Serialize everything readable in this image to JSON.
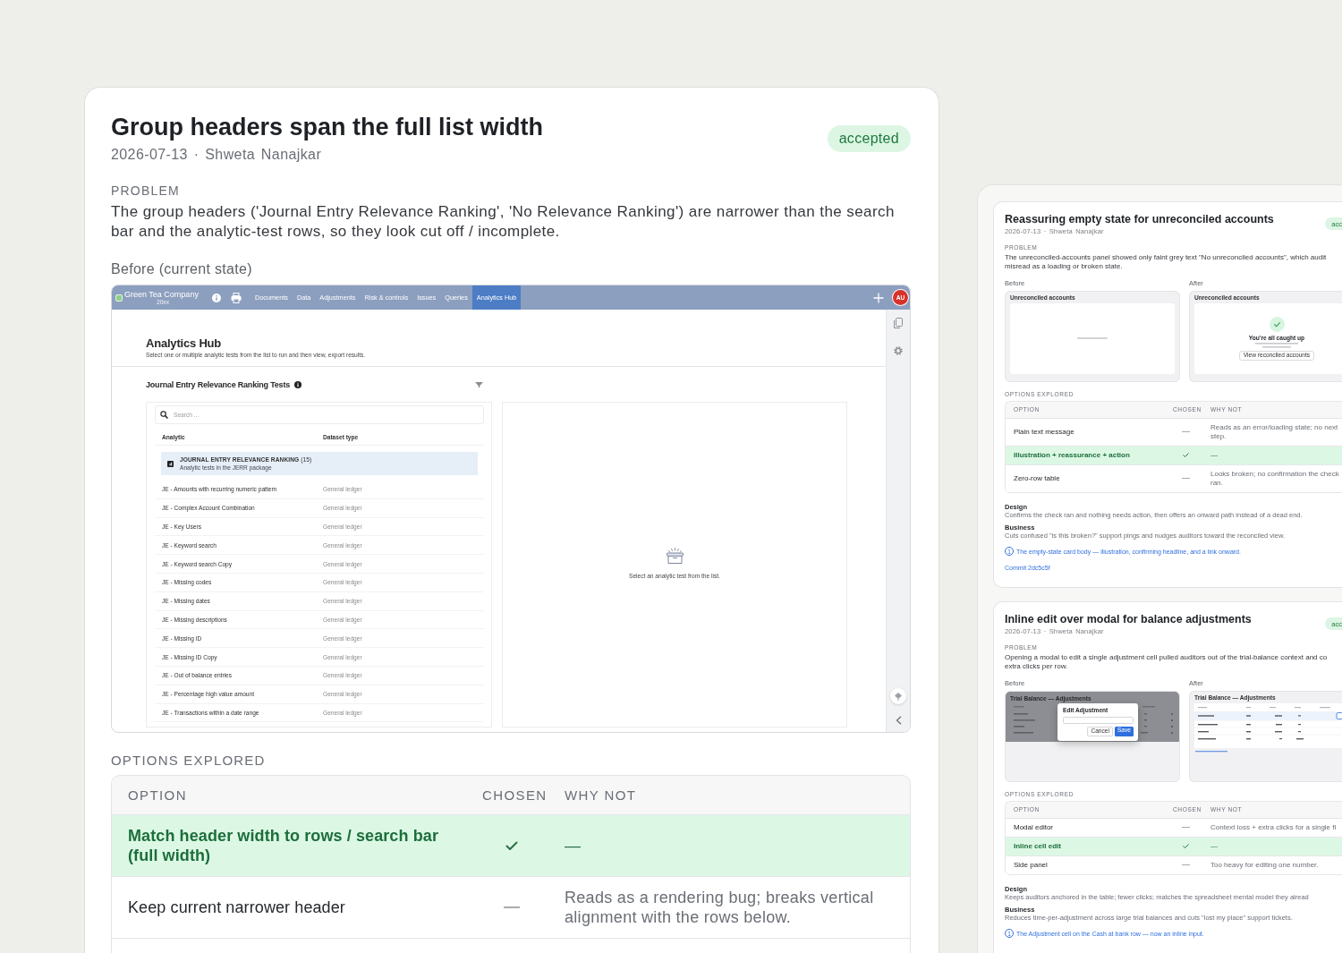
{
  "main_decision": {
    "title": "Group headers span the full list width",
    "byline": "2026-07-13 · Shweta Nanajkar",
    "status": "accepted",
    "problem_label": "PROBLEM",
    "problem": "The group headers ('Journal Entry Relevance Ranking', 'No Relevance Ranking') are narrower than the search bar and the analytic-test rows, so they look cut off / incomplete.",
    "before_label": "Before (current state)",
    "before_screenshot": {
      "company": "Green Tea Company",
      "company_year": "20xx",
      "nav": [
        {
          "label": "Documents",
          "selected": false
        },
        {
          "label": "Data",
          "selected": false
        },
        {
          "label": "Adjustments",
          "selected": false
        },
        {
          "label": "Risk & controls",
          "selected": false
        },
        {
          "label": "Issues",
          "selected": false
        },
        {
          "label": "Queries",
          "selected": false
        },
        {
          "label": "Analytics Hub",
          "selected": true
        }
      ],
      "avatar": "AU",
      "page_title": "Analytics Hub",
      "page_subtitle": "Select one or multiple analytic tests from the list to run and then view, export results.",
      "section_title": "Journal Entry Relevance Ranking Tests",
      "search_placeholder": "Search ...",
      "columns": [
        "Analytic",
        "Dataset type"
      ],
      "group": {
        "title": "**JOURNAL ENTRY RELEVANCE RANKING** (15)",
        "subtitle": "Analytic tests in the JERR package"
      },
      "rows": [
        {
          "analytic": "JE - Amounts with recurring numeric pattern",
          "dataset_type": "General ledger"
        },
        {
          "analytic": "JE - Complex Account Combination",
          "dataset_type": "General ledger"
        },
        {
          "analytic": "JE - Key Users",
          "dataset_type": "General ledger"
        },
        {
          "analytic": "JE - Keyword search",
          "dataset_type": "General ledger"
        },
        {
          "analytic": "JE - Keyword search Copy",
          "dataset_type": "General ledger"
        },
        {
          "analytic": "JE - Missing codes",
          "dataset_type": "General ledger"
        },
        {
          "analytic": "JE - Missing dates",
          "dataset_type": "General ledger"
        },
        {
          "analytic": "JE - Missing descriptions",
          "dataset_type": "General ledger"
        },
        {
          "analytic": "JE - Missing ID",
          "dataset_type": "General ledger"
        },
        {
          "analytic": "JE - Missing ID Copy",
          "dataset_type": "General ledger"
        },
        {
          "analytic": "JE - Out of balance entries",
          "dataset_type": "General ledger"
        },
        {
          "analytic": "JE - Percentage high value amount",
          "dataset_type": "General ledger"
        },
        {
          "analytic": "JE - Transactions within a date range",
          "dataset_type": "General ledger"
        }
      ],
      "empty_message": "Select an analytic test from the list."
    },
    "options_label": "OPTIONS EXPLORED",
    "options_columns": [
      "OPTION",
      "CHOSEN",
      "WHY NOT"
    ],
    "options": [
      {
        "option": "Match header width to rows / search bar (full width)",
        "chosen": true,
        "why_not": "—"
      },
      {
        "option": "Keep current narrower header",
        "chosen": false,
        "why_not": "Reads as a rendering bug; breaks vertical alignment with the rows below."
      }
    ]
  },
  "other_decisions": [
    {
      "title": "Reassuring empty state for unreconciled accounts",
      "byline": "2026-07-13 · Shweta Nanajkar",
      "status": "acc",
      "problem_label": "PROBLEM",
      "problem_lines": [
        "The unreconciled-accounts panel showed only faint grey text \"No unreconciled accounts\", which audit",
        "misread as a loading or broken state."
      ],
      "before_label": "Before",
      "after_label": "After",
      "before": {
        "kind": "empty_plain",
        "panel_title": "Unreconciled accounts"
      },
      "after": {
        "kind": "empty_state",
        "panel_title": "Unreconciled accounts",
        "headline": "You're all caught up",
        "button": "View reconciled accounts"
      },
      "options_label": "OPTIONS EXPLORED",
      "options_columns": [
        "OPTION",
        "CHOSEN",
        "WHY NOT"
      ],
      "options": [
        {
          "option": "Plain text message",
          "chosen": false,
          "why_not": "Reads as an error/loading state; no next step."
        },
        {
          "option": "Illustration + reassurance + action",
          "chosen": true,
          "why_not": "—"
        },
        {
          "option": "Zero-row table",
          "chosen": false,
          "why_not": "Looks broken; no confirmation the check ran."
        }
      ],
      "design_label": "Design",
      "design": "Confirms the check ran and nothing needs action, then offers an onward path instead of a dead end.",
      "business_label": "Business",
      "business": "Cuts confused \"is this broken?\" support pings and nudges auditors toward the reconciled view.",
      "annotations": [
        {
          "marker": "1",
          "text": "The empty-state card body — illustration, confirming headline, and a link onward."
        }
      ],
      "commit": "Commit 2dc5c5f"
    },
    {
      "title": "Inline edit over modal for balance adjustments",
      "byline": "2026-07-13 · Shweta Nanajkar",
      "status": "acc",
      "problem_label": "PROBLEM",
      "problem_lines": [
        "Opening a modal to edit a single adjustment cell pulled auditors out of the trial-balance context and co",
        "extra clicks per row."
      ],
      "before_label": "Before",
      "after_label": "After",
      "before": {
        "kind": "modal_edit",
        "table_title": "Trial Balance — Adjustments",
        "modal_title": "Edit Adjustment",
        "cancel": "Cancel",
        "save": "Save"
      },
      "after": {
        "kind": "inline_edit",
        "table_title": "Trial Balance — Adjustments"
      },
      "options_label": "OPTIONS EXPLORED",
      "options_columns": [
        "OPTION",
        "CHOSEN",
        "WHY NOT"
      ],
      "options": [
        {
          "option": "Modal editor",
          "chosen": false,
          "why_not": "Context loss + extra clicks for a single fi"
        },
        {
          "option": "Inline cell edit",
          "chosen": true,
          "why_not": "—"
        },
        {
          "option": "Side panel",
          "chosen": false,
          "why_not": "Too heavy for editing one number."
        }
      ],
      "design_label": "Design",
      "design": "Keeps auditors anchored in the table; fewer clicks; matches the spreadsheet mental model they alread",
      "business_label": "Business",
      "business": "Reduces time-per-adjustment across large trial balances and cuts \"lost my place\" support tickets.",
      "annotations": [
        {
          "marker": "1",
          "text": "The Adjustment cell on the Cash at bank row — now an inline input."
        }
      ]
    }
  ]
}
